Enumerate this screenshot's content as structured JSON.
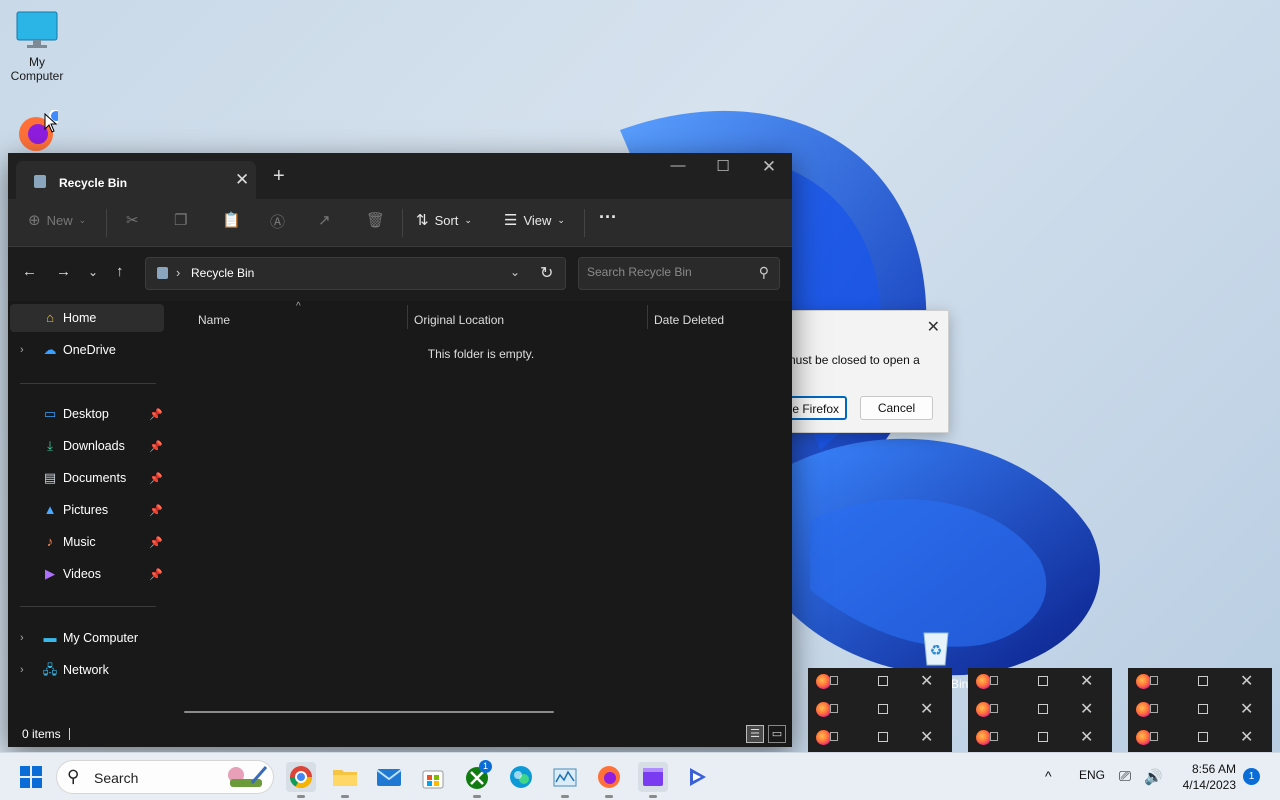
{
  "desktop": {
    "icons": [
      {
        "label": "My Computer"
      }
    ],
    "recycle_bin_partial_label": "Bin"
  },
  "firefox_dialog": {
    "message": "nust be closed to open a",
    "close_firefox_button": "se Firefox",
    "cancel_button": "Cancel"
  },
  "explorer": {
    "tab": {
      "title": "Recycle Bin"
    },
    "toolbar": {
      "new_label": "New",
      "sort_label": "Sort",
      "view_label": "View",
      "more_label": "···"
    },
    "address": {
      "path": "Recycle Bin"
    },
    "search": {
      "placeholder": "Search Recycle Bin"
    },
    "nav": {
      "home": "Home",
      "onedrive": "OneDrive",
      "quick_access": [
        "Desktop",
        "Downloads",
        "Documents",
        "Pictures",
        "Music",
        "Videos"
      ],
      "my_computer": "My Computer",
      "network": "Network"
    },
    "columns": [
      "Name",
      "Original Location",
      "Date Deleted"
    ],
    "empty_message": "This folder is empty.",
    "status": {
      "item_count": "0 items"
    }
  },
  "taskbar": {
    "search_label": "Search",
    "language": "ENG",
    "time": "8:56 AM",
    "date": "4/14/2023",
    "notification_count": "1",
    "xbox_badge": "1"
  },
  "colors": {
    "accent": "#0a6cd6",
    "explorer_bg": "#191919",
    "wallpaper_blue": "#1d5fe0"
  }
}
